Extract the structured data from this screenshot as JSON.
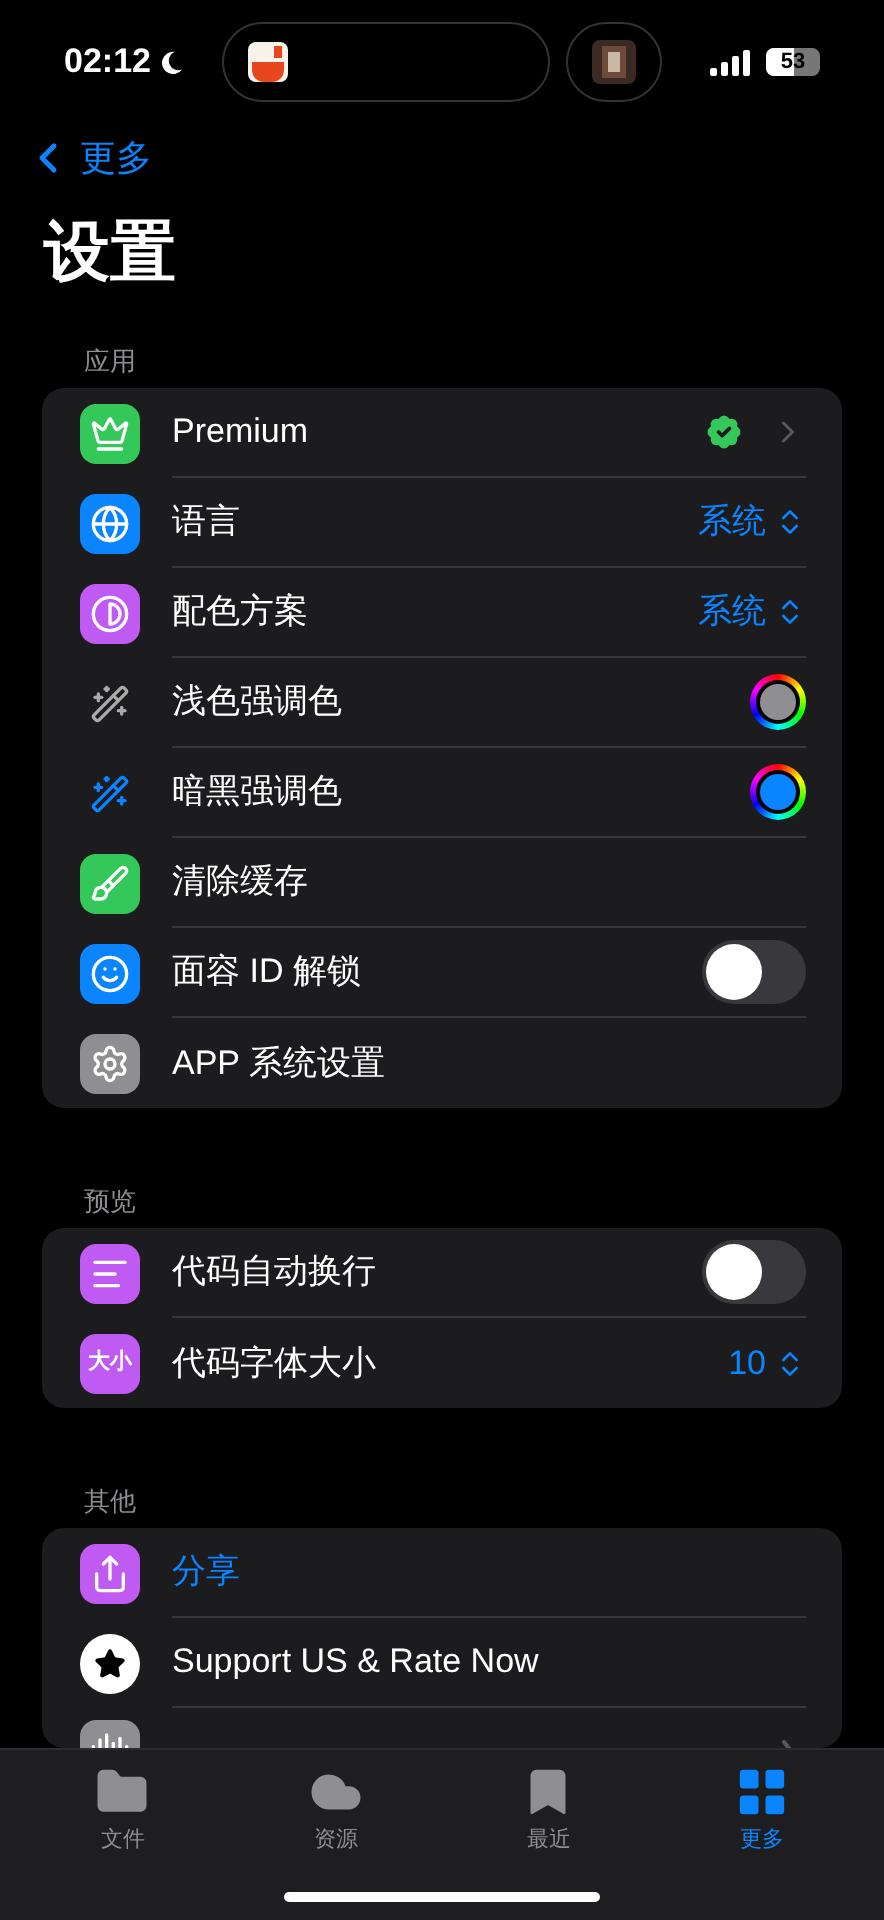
{
  "status_bar": {
    "time": "02:12",
    "battery": "53"
  },
  "nav": {
    "back": "更多",
    "title": "设置"
  },
  "sections": [
    {
      "header": "应用",
      "rows": [
        {
          "kind": "nav",
          "label": "Premium"
        },
        {
          "kind": "picker",
          "label": "语言",
          "value": "系统"
        },
        {
          "kind": "picker",
          "label": "配色方案",
          "value": "系统"
        },
        {
          "kind": "color",
          "label": "浅色强调色",
          "color": "#8e8e93"
        },
        {
          "kind": "color",
          "label": "暗黑强调色",
          "color": "#0a84ff"
        },
        {
          "kind": "plain",
          "label": "清除缓存"
        },
        {
          "kind": "toggle",
          "label": "面容 ID 解锁",
          "on": false
        },
        {
          "kind": "plain",
          "label": "APP 系统设置"
        }
      ]
    },
    {
      "header": "预览",
      "rows": [
        {
          "kind": "toggle",
          "label": "代码自动换行",
          "on": false
        },
        {
          "kind": "picker",
          "label": "代码字体大小",
          "value": "10",
          "icon_text": "大小"
        }
      ]
    },
    {
      "header": "其他",
      "rows": [
        {
          "kind": "link",
          "label": "分享"
        },
        {
          "kind": "plain",
          "label": "Support US & Rate Now"
        },
        {
          "kind": "hidden"
        }
      ]
    }
  ],
  "tab_bar": [
    {
      "label": "文件",
      "selected": false
    },
    {
      "label": "资源",
      "selected": false
    },
    {
      "label": "最近",
      "selected": false
    },
    {
      "label": "更多",
      "selected": true
    }
  ]
}
